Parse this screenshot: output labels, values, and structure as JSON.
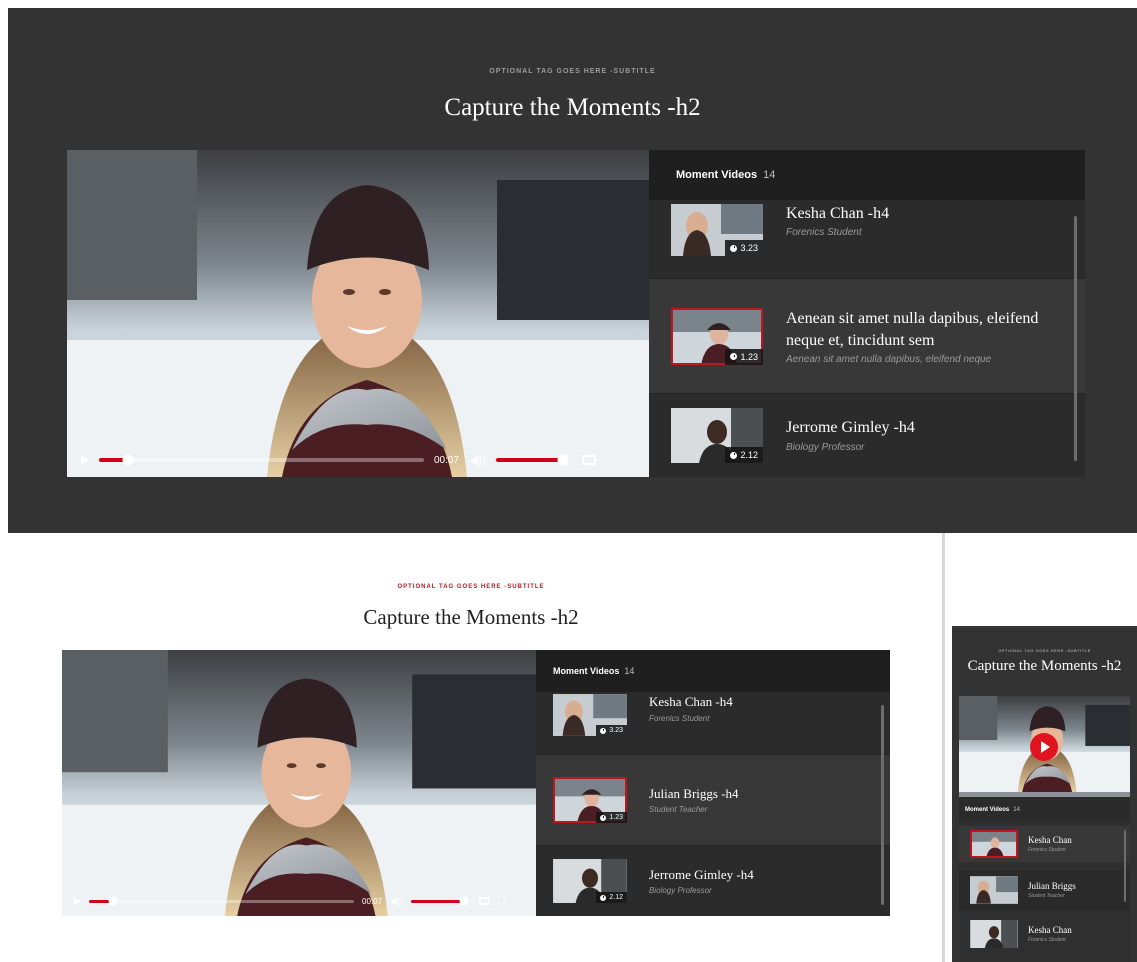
{
  "desktop_dark": {
    "subtitle": "OPTIONAL TAG GOES HERE -SUBTITLE",
    "title": "Capture the Moments -h2",
    "player": {
      "time": "00:07",
      "progress": 0.09,
      "volume": 0.95
    },
    "panel_label": "Moment Videos",
    "panel_count": "14",
    "items": [
      {
        "title": "Kesha Chan -h4",
        "subtitle": "Forenics Student",
        "duration": "3.23",
        "selected": false
      },
      {
        "title": "Aenean sit amet nulla dapibus, eleifend neque et, tincidunt sem",
        "subtitle": "Aenean sit amet nulla dapibus, eleifend neque",
        "duration": "1.23",
        "selected": true
      },
      {
        "title": "Jerrome Gimley -h4",
        "subtitle": "Biology Professor",
        "duration": "2.12",
        "selected": false
      }
    ]
  },
  "desktop_light": {
    "subtitle": "OPTIONAL TAG GOES HERE -SUBTITLE",
    "title": "Capture the Moments -h2",
    "player": {
      "time": "00:07",
      "progress": 0.09,
      "volume": 0.95
    },
    "panel_label": "Moment Videos",
    "panel_count": "14",
    "items": [
      {
        "title": "Kesha Chan -h4",
        "subtitle": "Forenics Student",
        "duration": "3.23",
        "selected": false
      },
      {
        "title": "Julian Briggs -h4",
        "subtitle": "Student Teacher",
        "duration": "1.23",
        "selected": true
      },
      {
        "title": "Jerrome Gimley -h4",
        "subtitle": "Biology Professor",
        "duration": "2.12",
        "selected": false
      }
    ]
  },
  "mobile": {
    "subtitle": "OPTIONAL TAG GOES HERE -SUBTITLE",
    "title": "Capture the Moments -h2",
    "panel_label": "Moment Videos",
    "panel_count": "14",
    "items": [
      {
        "title": "Kesha Chan",
        "subtitle": "Forenics Student",
        "selected": true
      },
      {
        "title": "Julian Briggs",
        "subtitle": "Student Teacher",
        "selected": false
      },
      {
        "title": "Kesha Chan",
        "subtitle": "Forenics Student",
        "selected": false
      }
    ]
  },
  "colors": {
    "dark_bg": "#333333",
    "accent_red": "#d0021b",
    "panel_bg": "#2b2b2b",
    "panel_header_bg": "#1f1f1f"
  },
  "icons": [
    "play-icon",
    "volume-icon",
    "captions-icon",
    "fullscreen-icon",
    "clock-icon",
    "play-button-icon"
  ]
}
